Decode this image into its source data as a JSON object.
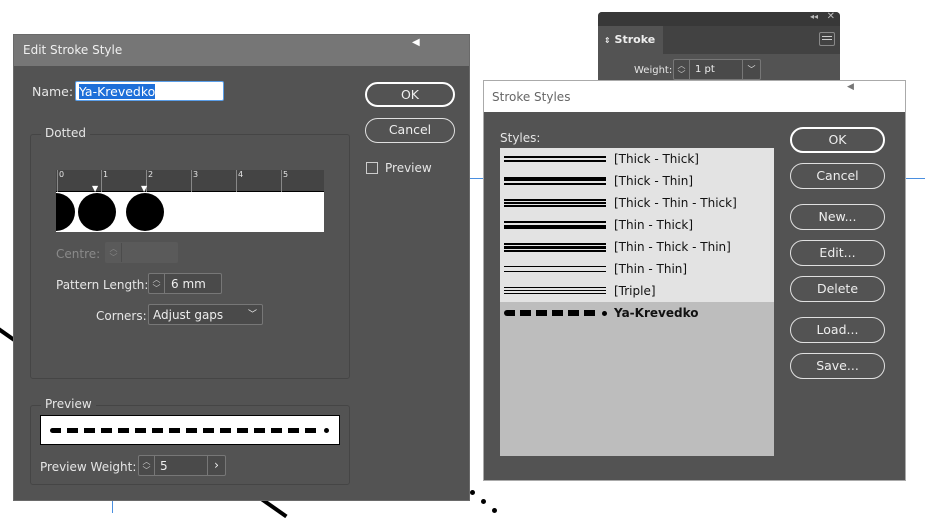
{
  "edit_dialog": {
    "title": "Edit Stroke Style",
    "name_label": "Name:",
    "name_value": "Ya-Krevedko",
    "ok": "OK",
    "cancel": "Cancel",
    "preview_checkbox": "Preview",
    "preview_checked": false,
    "type_group": "Dotted",
    "ruler_ticks": [
      "0",
      "1",
      "2",
      "3",
      "4",
      "5"
    ],
    "centre_label": "Centre:",
    "centre_value": "",
    "pattern_length_label": "Pattern Length:",
    "pattern_length_value": "6 mm",
    "corners_label": "Corners:",
    "corners_value": "Adjust gaps",
    "preview_group": "Preview",
    "preview_weight_label": "Preview Weight:",
    "preview_weight_value": "5"
  },
  "stroke_panel": {
    "title": "Stroke",
    "weight_label": "Weight:",
    "weight_value": "1 pt"
  },
  "styles_dialog": {
    "title": "Stroke Styles",
    "styles_label": "Styles:",
    "styles": [
      {
        "name": "[Thick - Thick]"
      },
      {
        "name": "[Thick - Thin]"
      },
      {
        "name": "[Thick - Thin - Thick]"
      },
      {
        "name": "[Thin - Thick]"
      },
      {
        "name": "[Thin - Thick - Thin]"
      },
      {
        "name": "[Thin - Thin]"
      },
      {
        "name": "[Triple]"
      },
      {
        "name": "Ya-Krevedko",
        "selected": true
      }
    ],
    "buttons": {
      "ok": "OK",
      "cancel": "Cancel",
      "new": "New...",
      "edit": "Edit...",
      "delete": "Delete",
      "load": "Load...",
      "save": "Save..."
    }
  },
  "colors": {
    "dialog_bg": "#535353",
    "selection": "#1e6fd9",
    "guide": "#4a8fe0"
  }
}
